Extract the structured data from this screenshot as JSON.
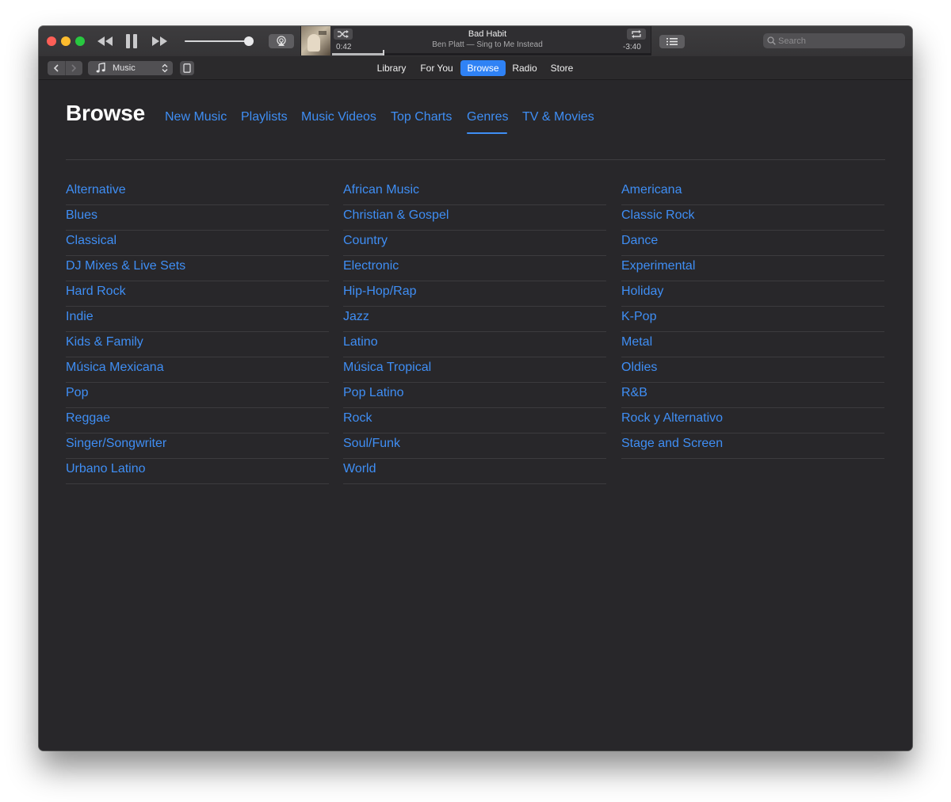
{
  "player": {
    "track_title": "Bad Habit",
    "track_subtitle": "Ben Platt — Sing to Me Instead",
    "elapsed": "0:42",
    "remaining": "-3:40",
    "progress_fraction": 0.16,
    "volume_fraction": 0.97
  },
  "search": {
    "placeholder": "Search"
  },
  "toolbar": {
    "media_kind": "Music",
    "sections": [
      {
        "label": "Library",
        "active": false
      },
      {
        "label": "For You",
        "active": false
      },
      {
        "label": "Browse",
        "active": true
      },
      {
        "label": "Radio",
        "active": false
      },
      {
        "label": "Store",
        "active": false
      }
    ]
  },
  "browse": {
    "title": "Browse",
    "tabs": [
      {
        "label": "New Music",
        "active": false
      },
      {
        "label": "Playlists",
        "active": false
      },
      {
        "label": "Music Videos",
        "active": false
      },
      {
        "label": "Top Charts",
        "active": false
      },
      {
        "label": "Genres",
        "active": true
      },
      {
        "label": "TV & Movies",
        "active": false
      }
    ],
    "genre_columns": [
      [
        "Alternative",
        "Blues",
        "Classical",
        "DJ Mixes & Live Sets",
        "Hard Rock",
        "Indie",
        "Kids & Family",
        "Música Mexicana",
        "Pop",
        "Reggae",
        "Singer/Songwriter",
        "Urbano Latino"
      ],
      [
        "African Music",
        "Christian & Gospel",
        "Country",
        "Electronic",
        "Hip-Hop/Rap",
        "Jazz",
        "Latino",
        "Música Tropical",
        "Pop Latino",
        "Rock",
        "Soul/Funk",
        "World"
      ],
      [
        "Americana",
        "Classic Rock",
        "Dance",
        "Experimental",
        "Holiday",
        "K-Pop",
        "Metal",
        "Oldies",
        "R&B",
        "Rock y Alternativo",
        "Stage and Screen"
      ]
    ]
  },
  "colors": {
    "accent": "#3f8ef4",
    "active_tab_bg": "#2f82f5",
    "window_bg": "#28272a"
  }
}
